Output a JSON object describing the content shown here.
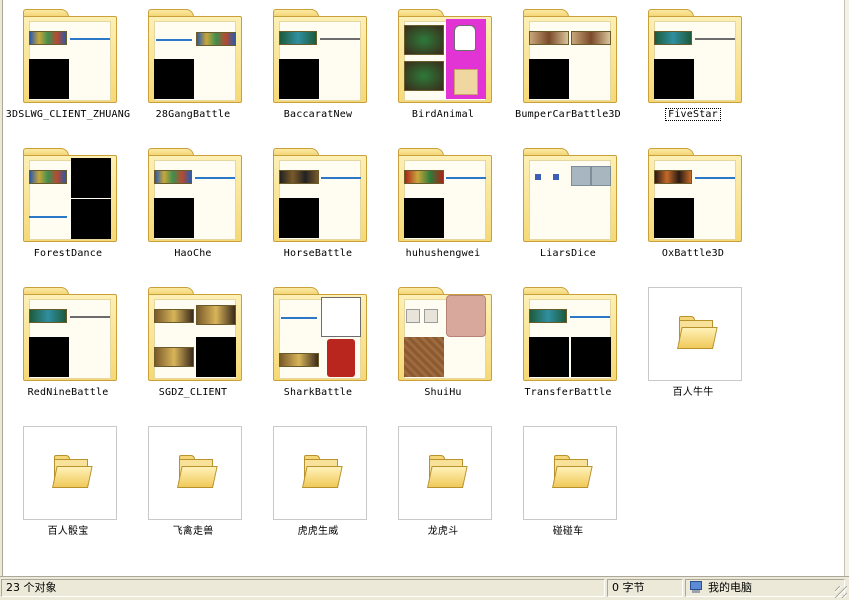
{
  "items": [
    {
      "label": "3DSLWG_CLIENT_ZHUANG"
    },
    {
      "label": "28GangBattle"
    },
    {
      "label": "BaccaratNew"
    },
    {
      "label": "BirdAnimal"
    },
    {
      "label": "BumperCarBattle3D"
    },
    {
      "label": "FiveStar"
    },
    {
      "label": "ForestDance"
    },
    {
      "label": "HaoChe"
    },
    {
      "label": "HorseBattle"
    },
    {
      "label": "huhushengwei"
    },
    {
      "label": "LiarsDice"
    },
    {
      "label": "OxBattle3D"
    },
    {
      "label": "RedNineBattle"
    },
    {
      "label": "SGDZ_CLIENT"
    },
    {
      "label": "SharkBattle"
    },
    {
      "label": "ShuiHu"
    },
    {
      "label": "TransferBattle"
    },
    {
      "label": "百人牛牛"
    },
    {
      "label": "百人骰宝"
    },
    {
      "label": "飞禽走兽"
    },
    {
      "label": "虎虎生威"
    },
    {
      "label": "龙虎斗"
    },
    {
      "label": "碰碰车"
    }
  ],
  "status": {
    "object_count": "23 个对象",
    "size": "0 字节",
    "location": "我的电脑"
  },
  "colors": {
    "folder_yellow": "#f6d976",
    "status_bg": "#ece9d8"
  },
  "icons": {
    "folder": "folder-icon",
    "computer": "my-computer-icon"
  }
}
